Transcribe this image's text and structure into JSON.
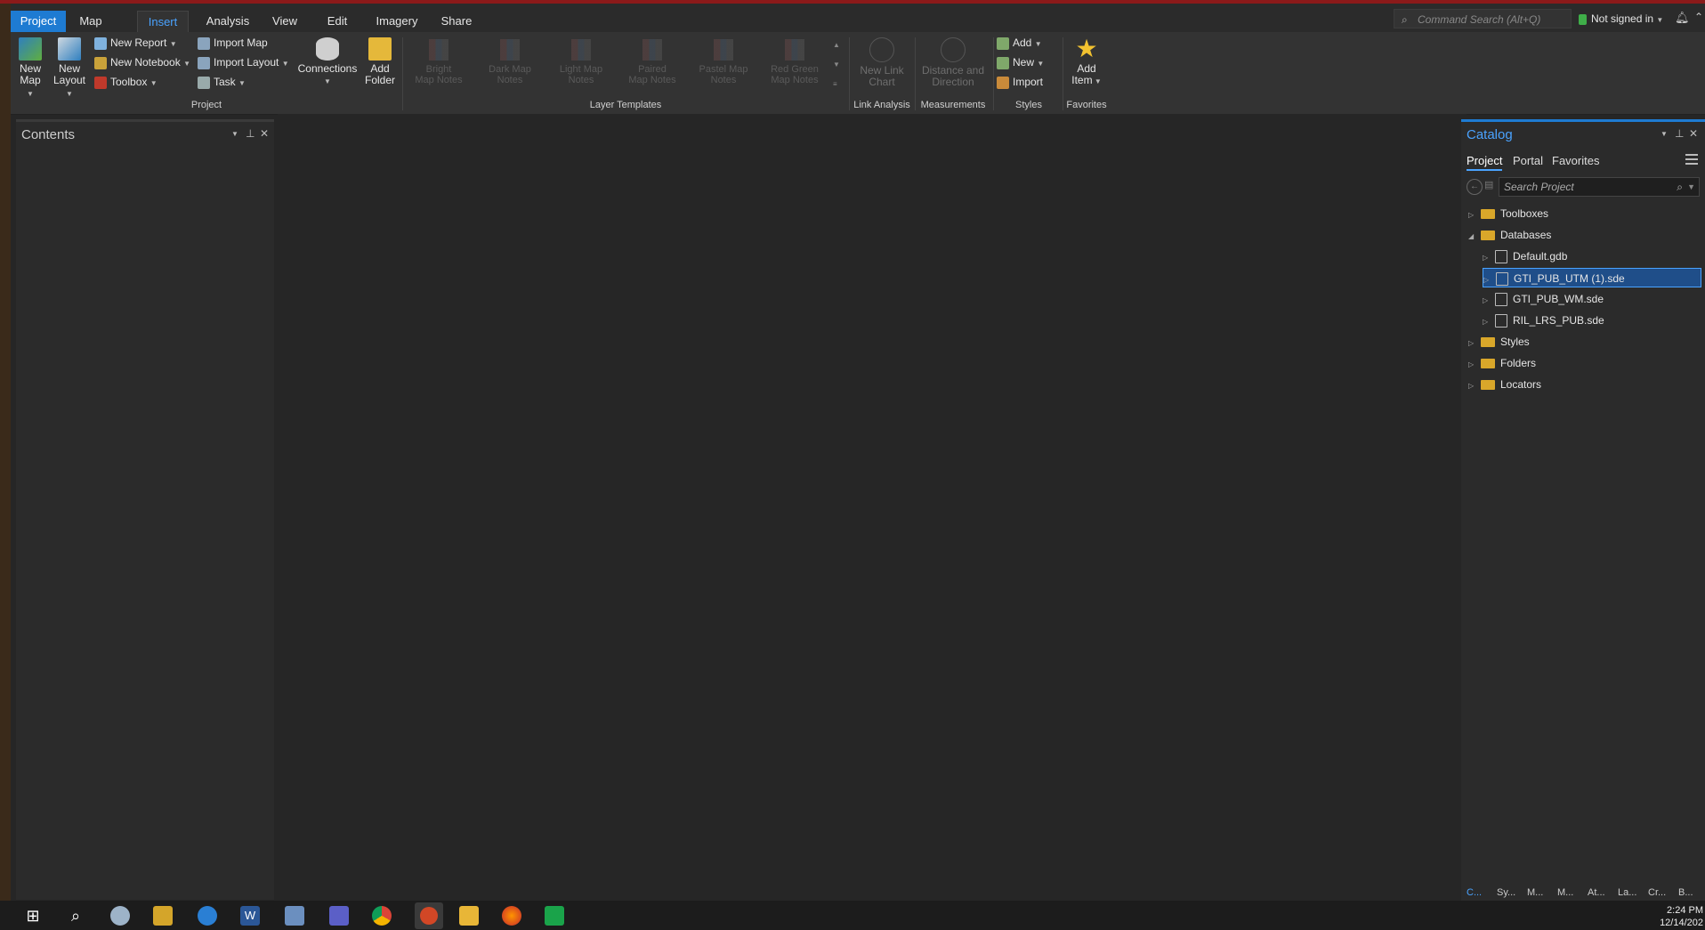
{
  "tabs": [
    "Project",
    "Map",
    "Insert",
    "Analysis",
    "View",
    "Edit",
    "Imagery",
    "Share"
  ],
  "command_search": {
    "placeholder": "Command Search (Alt+Q)"
  },
  "signin": "Not signed in",
  "ribbon": {
    "new_map": [
      "New",
      "Map"
    ],
    "new_layout": [
      "New",
      "Layout"
    ],
    "new_report": "New Report",
    "new_notebook": "New Notebook",
    "toolbox": "Toolbox",
    "import_map": "Import Map",
    "import_layout": "Import Layout",
    "task": "Task",
    "connections": "Connections",
    "add_folder": [
      "Add",
      "Folder"
    ],
    "project_group": "Project",
    "templates": [
      [
        "Bright",
        "Map Notes"
      ],
      [
        "Dark Map",
        "Notes"
      ],
      [
        "Light Map",
        "Notes"
      ],
      [
        "Paired",
        "Map Notes"
      ],
      [
        "Pastel Map",
        "Notes"
      ],
      [
        "Red Green",
        "Map Notes"
      ]
    ],
    "templates_group": "Layer Templates",
    "new_link_chart": [
      "New Link",
      "Chart"
    ],
    "link_group": "Link Analysis",
    "distance": [
      "Distance and",
      "Direction"
    ],
    "measure_group": "Measurements",
    "styles_add": "Add",
    "styles_new": "New",
    "styles_import": "Import",
    "styles_group": "Styles",
    "add_item": [
      "Add",
      "Item"
    ],
    "favorites_group": "Favorites"
  },
  "contents": {
    "title": "Contents"
  },
  "catalog": {
    "title": "Catalog",
    "tabs": [
      "Project",
      "Portal",
      "Favorites"
    ],
    "search_placeholder": "Search Project",
    "tree": {
      "toolboxes": "Toolboxes",
      "databases": "Databases",
      "dbs": [
        "Default.gdb",
        "GTI_PUB_UTM (1).sde",
        "GTI_PUB_WM.sde",
        "RIL_LRS_PUB.sde"
      ],
      "styles": "Styles",
      "folders": "Folders",
      "locators": "Locators"
    },
    "bottom_tabs": [
      "C...",
      "Sy...",
      "M...",
      "M...",
      "At...",
      "La...",
      "Cr...",
      "B..."
    ]
  },
  "clock": {
    "time": "2:24 PM",
    "date": "12/14/202"
  },
  "colors": {
    "accent": "#1e7bd2",
    "folder": "#d9a72a",
    "selection": "#1f4e89"
  }
}
